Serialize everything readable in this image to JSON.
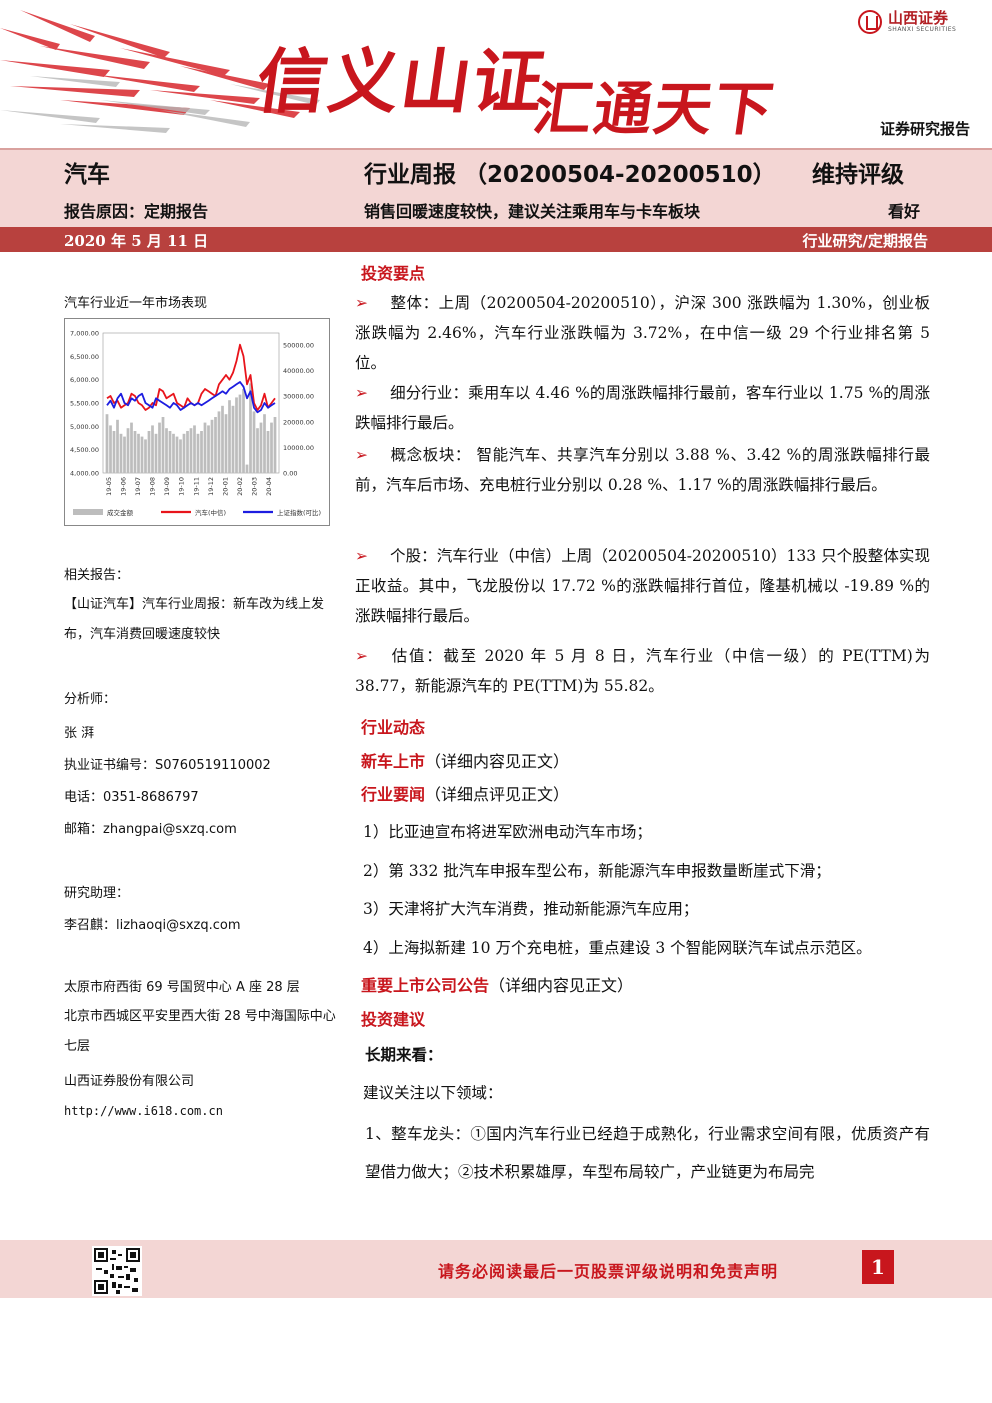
{
  "header": {
    "slogan_line1": "信义山证",
    "slogan_line2": "汇通天下",
    "logo_cn": "山西证券",
    "logo_en": "SHANXI SECURITIES",
    "doc_type": "证券研究报告"
  },
  "title_band": {
    "industry": "汽车",
    "report_title": "行业周报 （20200504-20200510）",
    "rating": "维持评级",
    "reason": "报告原因：定期报告",
    "headline": "销售回暖速度较快，建议关注乘用车与卡车板块",
    "view": "看好",
    "date": "2020 年 5 月 11 日",
    "category": "行业研究/定期报告"
  },
  "sidebar": {
    "chart_title": "汽车行业近一年市场表现",
    "related_label": "相关报告：",
    "related_report": "【山证汽车】汽车行业周报：新车改为线上发布，汽车消费回暖速度较快",
    "analyst_label": "分析师：",
    "analyst_name": "张 湃",
    "cert_no": "执业证书编号：S0760519110002",
    "phone": "电话：0351-8686797",
    "email": "邮箱：zhangpai@sxzq.com",
    "assistant_label": "研究助理：",
    "assistant": "李召麒：lizhaoqi@sxzq.com",
    "address1": "太原市府西街 69 号国贸中心 A 座 28 层",
    "address2": "北京市西城区平安里西大街 28 号中海国际中心七层",
    "company": "山西证券股份有限公司",
    "website": "http://www.i618.com.cn"
  },
  "main": {
    "sec_highlights": "投资要点",
    "bullets": [
      "整体：上周（20200504-20200510），沪深 300 涨跌幅为 1.30%，创业板涨跌幅为 2.46%，汽车行业涨跌幅为 3.72%，在中信一级 29 个行业排名第 5 位。",
      "细分行业：乘用车以 4.46 %的周涨跌幅排行最前，客车行业以 1.75 %的周涨跌幅排行最后。",
      "概念板块： 智能汽车、共享汽车分别以 3.88 %、3.42 %的周涨跌幅排行最前，汽车后市场、充电桩行业分别以 0.28 %、1.17 %的周涨跌幅排行最后。",
      "个股：汽车行业（中信）上周（20200504-20200510）133 只个股整体实现正收益。其中，飞龙股份以 17.72 %的涨跌幅排行首位，隆基机械以 -19.89 %的涨跌幅排行最后。",
      "估值：截至 2020 年 5 月 8 日，汽车行业（中信一级）的 PE(TTM)为 38.77，新能源汽车的 PE(TTM)为 55.82。"
    ],
    "sec_dynamics": "行业动态",
    "sec_newcars": "新车上市",
    "newcars_note": "（详细内容见正文）",
    "sec_news": "行业要闻",
    "news_note": "（详细点评见正文）",
    "news_items": [
      "1）比亚迪宣布将进军欧洲电动汽车市场；",
      "2）第 332 批汽车申报车型公布，新能源汽车申报数量断崖式下滑；",
      "3）天津将扩大汽车消费，推动新能源汽车应用；",
      "4）上海拟新建 10 万个充电桩，重点建设 3 个智能网联汽车试点示范区。"
    ],
    "sec_announce": "重要上市公司公告",
    "announce_note": "（详细内容见正文）",
    "sec_advice": "投资建议",
    "long_term": "长期来看：",
    "suggest": "建议关注以下领域：",
    "point1": "1、整车龙头：①国内汽车行业已经趋于成熟化，行业需求空间有限，优质资产有望借力做大；②技术积累雄厚，车型布局较广，产业链更为布局完"
  },
  "footer": {
    "disclaimer": "请务必阅读最后一页股票评级说明和免责声明",
    "page": "1"
  },
  "chart_data": {
    "type": "line",
    "title": "",
    "y_left_ticks": [
      "7,000.00",
      "6,500.00",
      "6,000.00",
      "5,500.00",
      "5,000.00",
      "4,500.00",
      "4,000.00"
    ],
    "y_right_ticks": [
      "50000.00",
      "40000.00",
      "30000.00",
      "20000.00",
      "10000.00",
      "0.00"
    ],
    "ylim_left": [
      4000,
      7000
    ],
    "ylim_right": [
      0,
      50000
    ],
    "x_ticks": [
      "19-05",
      "19-06",
      "19-07",
      "19-08",
      "19-09",
      "19-10",
      "19-11",
      "19-12",
      "20-01",
      "20-02",
      "20-03",
      "20-04"
    ],
    "legend": [
      "成交金额",
      "汽车(中信)",
      "上证指数(可比)"
    ],
    "legend_position": "bottom",
    "series": [
      {
        "name": "汽车(中信)",
        "color": "#e8141b",
        "axis": "left",
        "values": [
          5600,
          5650,
          5500,
          5550,
          5400,
          5450,
          5500,
          5700,
          5650,
          5500,
          5450,
          5350,
          5400,
          5500,
          5450,
          5800,
          5750,
          5600,
          5650,
          5700,
          5500,
          5450,
          5400,
          5600,
          5500,
          5450,
          5500,
          5700,
          5800,
          5750,
          5700,
          5650,
          5900,
          6000,
          6100,
          6000,
          6150,
          6400,
          6750,
          6500,
          5900,
          6100,
          5500,
          5350,
          5450,
          5700,
          5400,
          5500,
          5600
        ]
      },
      {
        "name": "上证指数(可比)",
        "color": "#1d1de0",
        "axis": "left",
        "values": [
          5450,
          5550,
          5400,
          5600,
          5700,
          5500,
          5450,
          5600,
          5550,
          5650,
          5700,
          5500,
          5450,
          5400,
          5600,
          5550,
          5500,
          5450,
          5400,
          5500,
          5450,
          5350,
          5400,
          5450,
          5500,
          5450,
          5500,
          5450,
          5500,
          5550,
          5600,
          5650,
          5700,
          5750,
          5700,
          5800,
          5850,
          5900,
          5950,
          5850,
          5600,
          5750,
          5400,
          5300,
          5350,
          5500,
          5400,
          5450,
          5500
        ]
      },
      {
        "name": "成交金额",
        "color": "#bdbdbd",
        "axis": "right",
        "values": [
          21000,
          17000,
          15000,
          19000,
          14000,
          13000,
          16000,
          18000,
          15000,
          14000,
          13000,
          12000,
          15000,
          17000,
          14000,
          18000,
          20000,
          16000,
          15000,
          14000,
          13000,
          12000,
          14000,
          15000,
          16000,
          17000,
          14000,
          15000,
          18000,
          17000,
          19000,
          20000,
          22000,
          24000,
          21000,
          26000,
          24000,
          27000,
          28000,
          30000,
          3000,
          32000,
          22000,
          16000,
          18000,
          21000,
          15000,
          18000,
          20000
        ]
      }
    ]
  }
}
